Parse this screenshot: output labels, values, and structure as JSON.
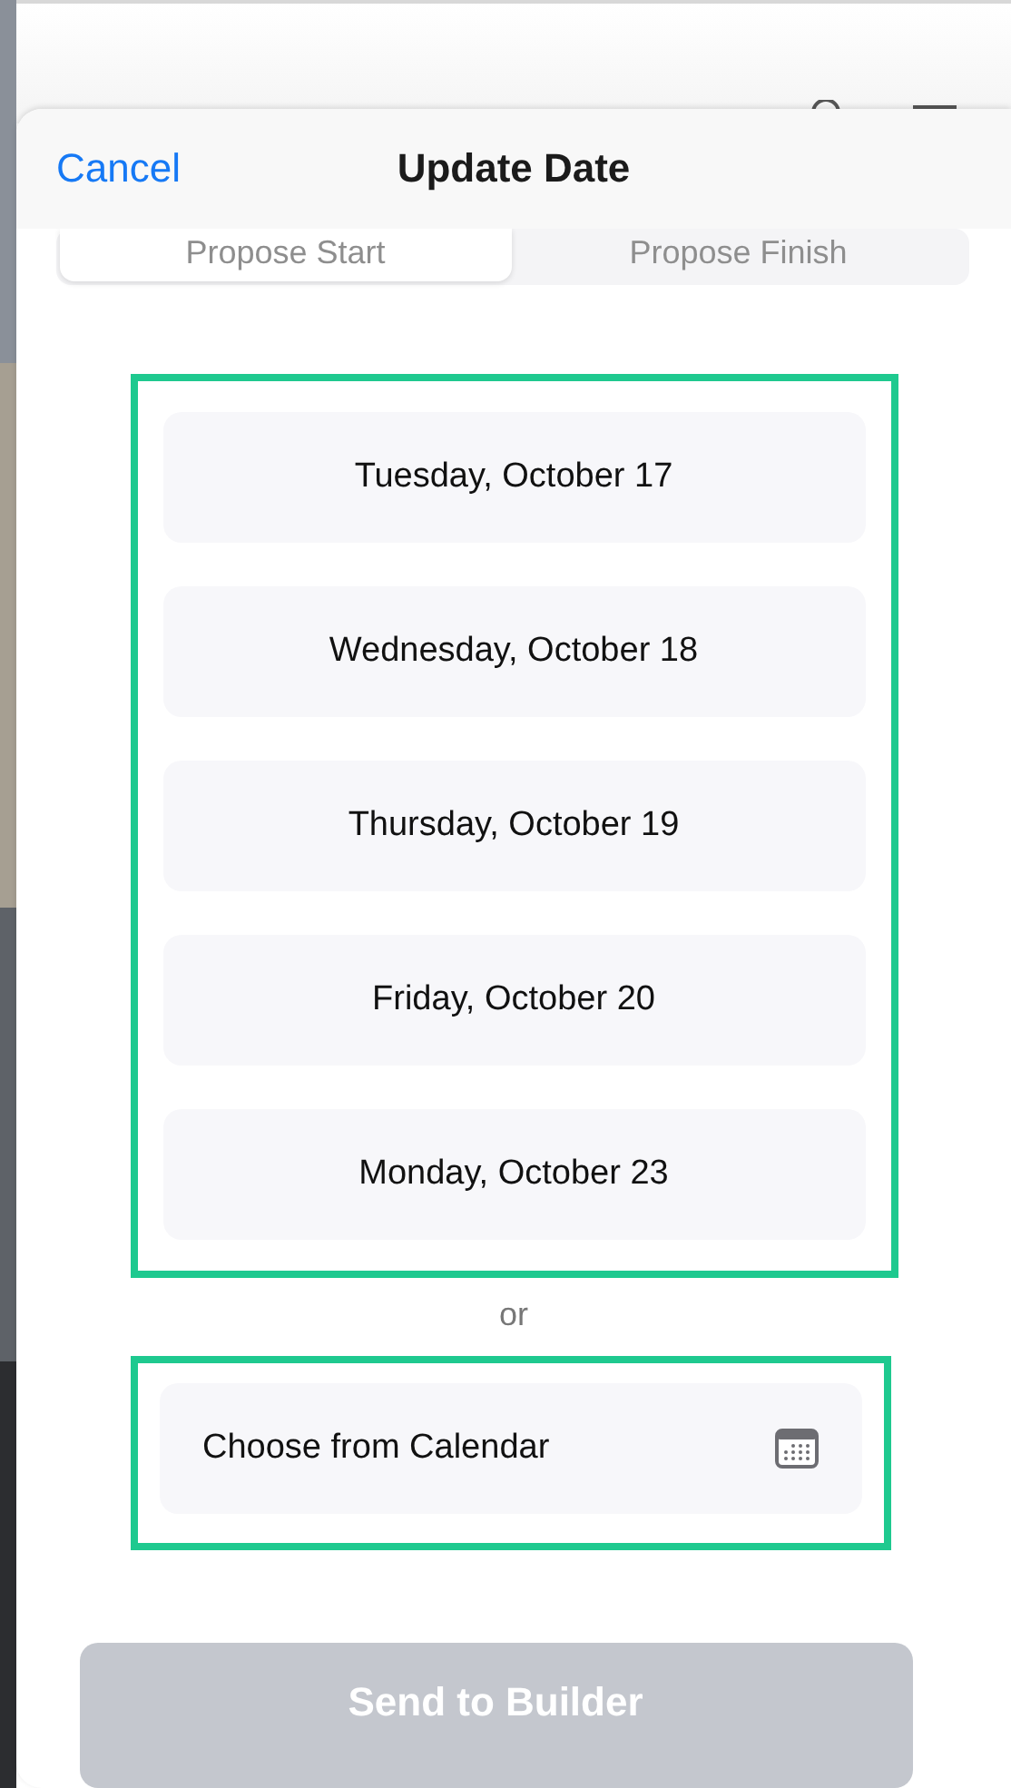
{
  "header": {
    "cancel": "Cancel",
    "title": "Update Date"
  },
  "tabs": [
    {
      "label": "Propose Start",
      "selected": true
    },
    {
      "label": "Propose Finish",
      "selected": false
    }
  ],
  "dates": [
    "Tuesday, October 17",
    "Wednesday, October 18",
    "Thursday, October 19",
    "Friday, October 20",
    "Monday, October 23"
  ],
  "separator": "or",
  "calendar": {
    "label": "Choose from Calendar"
  },
  "submit": {
    "label": "Send to Builder",
    "disabled": true
  }
}
